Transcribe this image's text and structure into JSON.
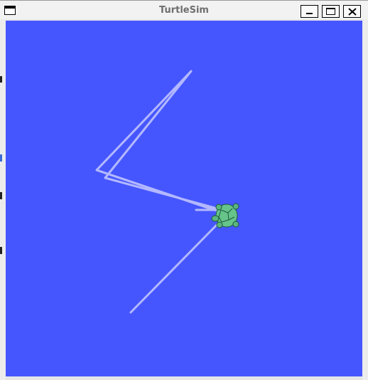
{
  "window": {
    "title": "TurtleSim",
    "buttons": {
      "menu_icon": "window-menu-icon",
      "minimize_icon": "minimize-icon",
      "maximize_icon": "maximize-icon",
      "close_icon": "close-icon"
    }
  },
  "canvas": {
    "background_color": "#4556ff",
    "pen_color": "#b3b8ff",
    "turtle": {
      "icon": "turtle-icon",
      "shell_color": "#66c38a"
    }
  }
}
